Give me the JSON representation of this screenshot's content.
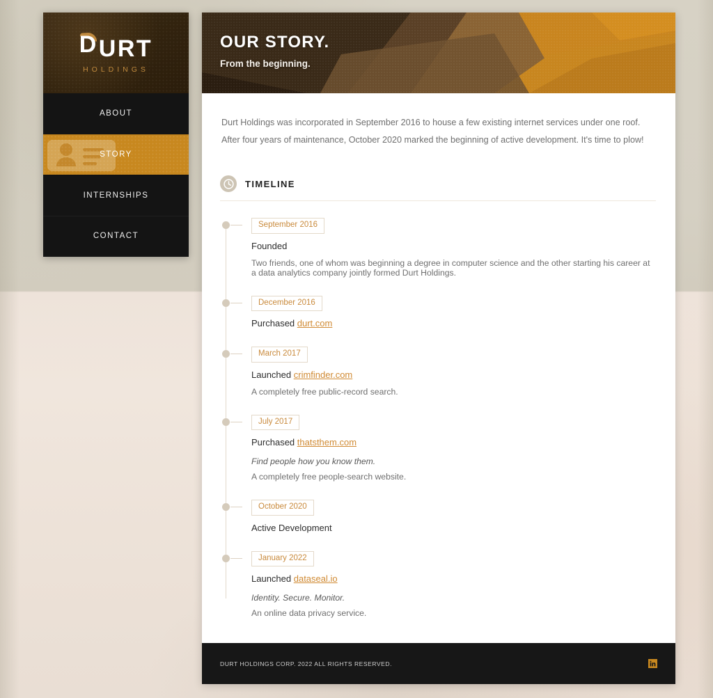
{
  "sidebar": {
    "brand": {
      "logo_letter_d": "D",
      "logo_rest": "URT",
      "logo_sub": "HOLDINGS",
      "swoosh_color": "#c08a3e"
    },
    "nav": [
      {
        "label": "ABOUT",
        "icon": "",
        "active": false
      },
      {
        "label": "STORY",
        "icon": "id-card-icon",
        "active": true
      },
      {
        "label": "INTERNSHIPS",
        "icon": "",
        "active": false
      },
      {
        "label": "CONTACT",
        "icon": "",
        "active": false
      }
    ],
    "active_color": "#c8881f"
  },
  "hero": {
    "title": "OUR STORY.",
    "subtitle": "From the beginning."
  },
  "intro": {
    "paragraph": "Durt Holdings was incorporated in September 2016 to house a few existing internet services under one roof. After four years of maintenance, October 2020 marked the beginning of active development. It's time to plow!"
  },
  "timeline_section": {
    "icon": "clock-icon",
    "title": "TIMELINE",
    "items": [
      {
        "date": "September 2016",
        "headline_prefix": "Founded",
        "link": "",
        "tagline": "",
        "description": "Two friends, one of whom was beginning a degree in computer science and the other starting his career at a data analytics company jointly formed Durt Holdings."
      },
      {
        "date": "December 2016",
        "headline_prefix": "Purchased ",
        "link": "durt.com",
        "tagline": "",
        "description": ""
      },
      {
        "date": "March 2017",
        "headline_prefix": "Launched ",
        "link": "crimfinder.com",
        "tagline": "",
        "description": "A completely free public-record search."
      },
      {
        "date": "July 2017",
        "headline_prefix": "Purchased ",
        "link": "thatsthem.com",
        "tagline": "Find people how you know them.",
        "description": "A completely free people-search website."
      },
      {
        "date": "October 2020",
        "headline_prefix": "Active Development",
        "link": "",
        "tagline": "",
        "description": ""
      },
      {
        "date": "January 2022",
        "headline_prefix": "Launched ",
        "link": "dataseal.io",
        "tagline": "Identity. Secure. Monitor.",
        "description": "An online data privacy service."
      }
    ]
  },
  "footer": {
    "copyright": "DURT HOLDINGS CORP. 2022 ALL RIGHTS RESERVED.",
    "social_icon": "linkedin-icon",
    "social_color": "#c8881f"
  }
}
